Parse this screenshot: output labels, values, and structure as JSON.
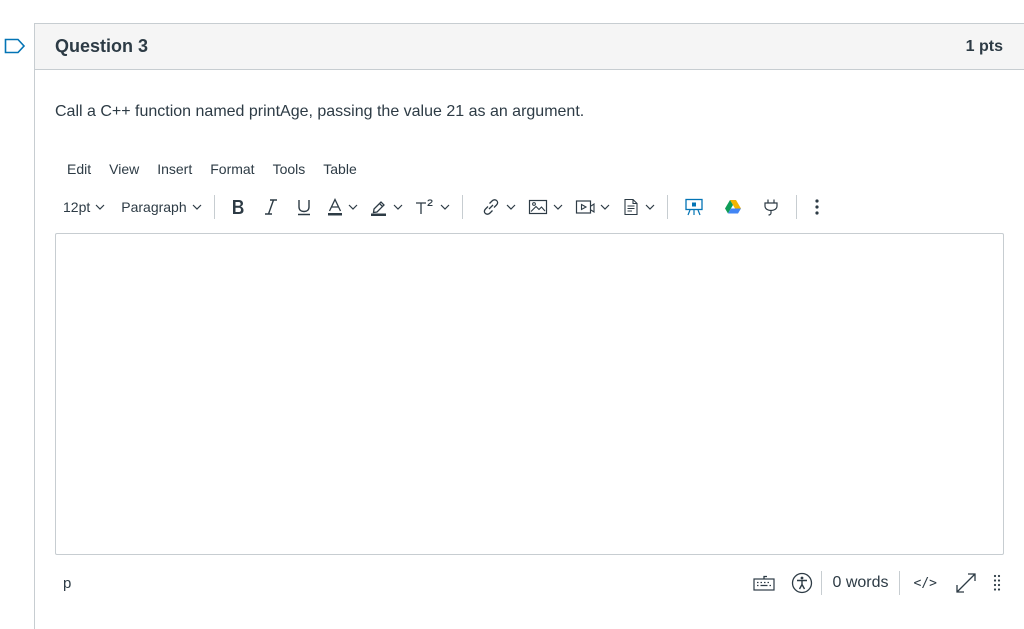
{
  "question": {
    "title": "Question 3",
    "points": "1 pts",
    "text": "Call a C++ function named printAge, passing the value 21 as an argument."
  },
  "editor": {
    "menu": [
      "Edit",
      "View",
      "Insert",
      "Format",
      "Tools",
      "Table"
    ],
    "font_size": "12pt",
    "block_format": "Paragraph",
    "toolbar_icons": [
      "bold-icon",
      "italic-icon",
      "underline-icon",
      "text-color-icon",
      "highlight-icon",
      "superscript-icon",
      "link-icon",
      "image-icon",
      "media-icon",
      "document-icon",
      "apps-icon",
      "google-drive-icon",
      "plugin-icon",
      "more-icon"
    ],
    "content": "",
    "status_path": "p",
    "word_count": "0 words",
    "html_toggle": "</>"
  },
  "colors": {
    "text": "#2d3b45",
    "border": "#c7cdd1",
    "header_bg": "#f5f5f5",
    "accent": "#0374b5"
  }
}
